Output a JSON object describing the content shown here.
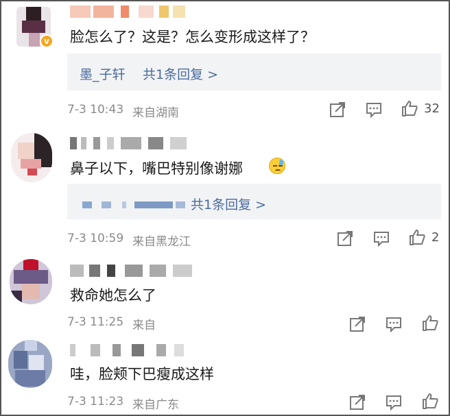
{
  "colors": {
    "link": "#4a6b9e",
    "meta": "#8a8a8a",
    "reply_bg": "#f2f3f5",
    "badge": "#f5a623"
  },
  "comments": [
    {
      "text": "脸怎么了？这是？怎么变形成这样了？",
      "reply_user": "墨_子轩",
      "reply_summary": "共1条回复 >",
      "time": "7-3 10:43",
      "location": "来自湖南",
      "likes": "32",
      "verified": true
    },
    {
      "text": "鼻子以下，嘴巴特别像谢娜",
      "reply_user": "",
      "reply_summary": "共1条回复 >",
      "time": "7-3 10:59",
      "location": "来自黑龙江",
      "likes": "2",
      "emoji": "sweat-smile-emoji"
    },
    {
      "text": "救命她怎么了",
      "time": "7-3 11:25",
      "location": "来自",
      "likes": ""
    },
    {
      "text": "哇，脸颊下巴瘦成这样",
      "time": "7-3 11:23",
      "location": "来自广东",
      "likes": ""
    }
  ],
  "icons": {
    "share": "share-icon",
    "comment": "comment-icon",
    "like": "like-icon",
    "verified": "verified-badge-icon"
  }
}
